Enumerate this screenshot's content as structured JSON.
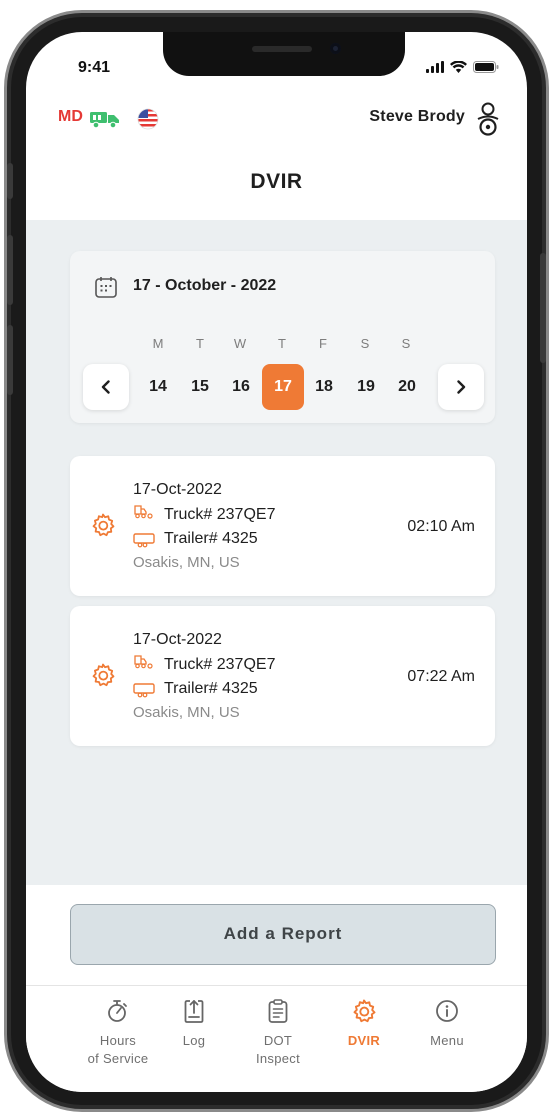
{
  "status_bar": {
    "time": "9:41"
  },
  "header": {
    "mode": "MD",
    "user_name": "Steve Brody",
    "title": "DVIR"
  },
  "calendar": {
    "date_label": "17 - October - 2022",
    "weekdays": [
      "M",
      "T",
      "W",
      "T",
      "F",
      "S",
      "S"
    ],
    "days": [
      "14",
      "15",
      "16",
      "17",
      "18",
      "19",
      "20"
    ],
    "selected_day": "17"
  },
  "reports": [
    {
      "date": "17-Oct-2022",
      "truck": "Truck# 237QE7",
      "trailer": "Trailer# 4325",
      "location": "Osakis, MN, US",
      "time": "02:10 Am"
    },
    {
      "date": "17-Oct-2022",
      "truck": "Truck# 237QE7",
      "trailer": "Trailer# 4325",
      "location": "Osakis, MN, US",
      "time": "07:22 Am"
    }
  ],
  "add_report_label": "Add a Report",
  "bottom_nav": [
    {
      "line1": "Hours",
      "line2": "of Service",
      "icon": "stopwatch-icon",
      "active": false
    },
    {
      "line1": "Log",
      "line2": "",
      "icon": "upload-log-icon",
      "active": false
    },
    {
      "line1": "DOT",
      "line2": "Inspect",
      "icon": "clipboard-icon",
      "active": false
    },
    {
      "line1": "DVIR",
      "line2": "",
      "icon": "gear-icon",
      "active": true
    },
    {
      "line1": "Menu",
      "line2": "",
      "icon": "info-icon",
      "active": false
    }
  ],
  "colors": {
    "accent": "#ef7a35",
    "mode_red": "#e53935",
    "truck_green": "#3fbf6f",
    "content_bg": "#ebeff1"
  }
}
